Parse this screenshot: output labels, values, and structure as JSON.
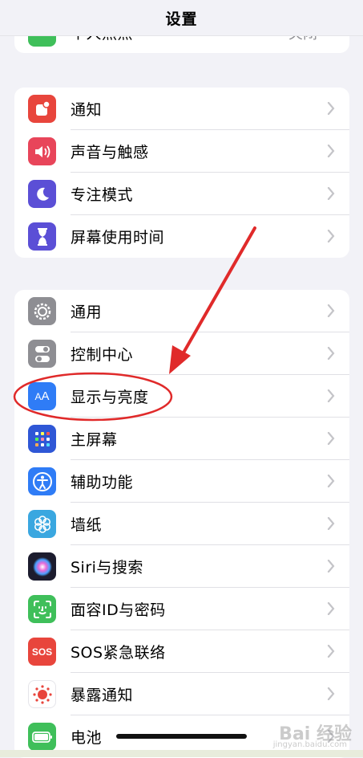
{
  "header": {
    "title": "设置"
  },
  "top_peek": {
    "label": "个人热点",
    "value": "关闭"
  },
  "group1": [
    {
      "label": "通知",
      "icon": "notification-icon",
      "color": "#e8453c"
    },
    {
      "label": "声音与触感",
      "icon": "speaker-icon",
      "color": "#e8455a"
    },
    {
      "label": "专注模式",
      "icon": "moon-icon",
      "color": "#5b4fd6"
    },
    {
      "label": "屏幕使用时间",
      "icon": "hourglass-icon",
      "color": "#5b4fd6"
    }
  ],
  "group2": [
    {
      "label": "通用",
      "icon": "gear-icon",
      "color": "#8e8e93"
    },
    {
      "label": "控制中心",
      "icon": "toggles-icon",
      "color": "#8e8e93"
    },
    {
      "label": "显示与亮度",
      "icon": "text-size-icon",
      "color": "#2f7cf6"
    },
    {
      "label": "主屏幕",
      "icon": "home-grid-icon",
      "color": "#2f57d6"
    },
    {
      "label": "辅助功能",
      "icon": "accessibility-icon",
      "color": "#2f7cf6"
    },
    {
      "label": "墙纸",
      "icon": "flower-icon",
      "color": "#3aa7e0"
    },
    {
      "label": "Siri与搜索",
      "icon": "siri-icon",
      "color": "#1c1c2e"
    },
    {
      "label": "面容ID与密码",
      "icon": "face-id-icon",
      "color": "#3fbf5a"
    },
    {
      "label": "SOS紧急联络",
      "icon": "sos-icon",
      "color": "#e8453c"
    },
    {
      "label": "暴露通知",
      "icon": "exposure-icon",
      "color": "#ffffff"
    },
    {
      "label": "电池",
      "icon": "battery-icon",
      "color": "#3fbf5a"
    }
  ],
  "watermark": {
    "text": "Bai 经验",
    "sub": "jingyan.baidu.com"
  },
  "annotation": {
    "color": "#e02a2a"
  }
}
